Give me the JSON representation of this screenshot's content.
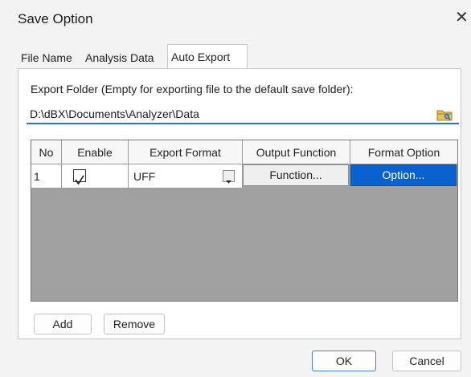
{
  "window": {
    "title": "Save Option"
  },
  "tabs": [
    {
      "label": "File Name"
    },
    {
      "label": "Analysis Data"
    },
    {
      "label": "Auto Export"
    }
  ],
  "export": {
    "label": "Export Folder (Empty for exporting file to the default save folder):",
    "folder_value": "D:\\dBX\\Documents\\Analyzer\\Data"
  },
  "table": {
    "columns": [
      "No",
      "Enable",
      "Export Format",
      "Output Function",
      "Format Option"
    ],
    "rows": [
      {
        "no": "1",
        "enabled": true,
        "format": "UFF",
        "function_button": "Function...",
        "option_button": "Option..."
      }
    ]
  },
  "buttons": {
    "add": "Add",
    "remove": "Remove",
    "ok": "OK",
    "cancel": "Cancel"
  },
  "colors": {
    "accent": "#0a62cf",
    "grid_background": "#a0a0a0",
    "input_underline": "#2a73c9"
  }
}
